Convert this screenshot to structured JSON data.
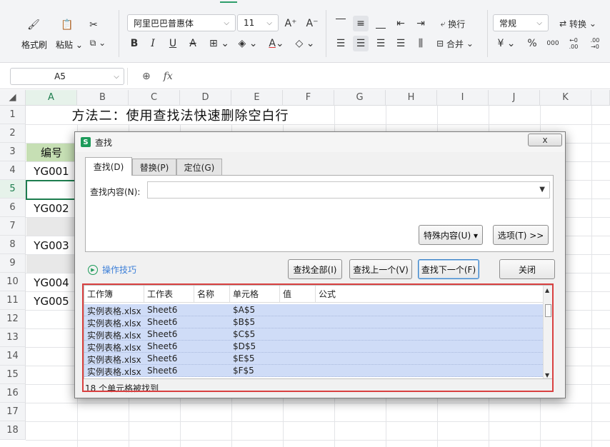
{
  "ribbon": {
    "format_painter": "格式刷",
    "paste": "粘贴",
    "font_name": "阿里巴巴普惠体",
    "font_size": "11",
    "font_grow": "A⁺",
    "font_shrink": "A⁻",
    "bold": "B",
    "italic": "I",
    "underline": "U",
    "strike": "A",
    "font_color": "A",
    "wrap": "换行",
    "merge": "合并",
    "number_format": "常规",
    "convert": "转换",
    "currency": "¥",
    "percent": "%",
    "thousands": "000",
    "inc_decimal": "←0 .00",
    "dec_decimal": ".00 →0"
  },
  "formula_bar": {
    "name_box": "A5",
    "fx": "fx"
  },
  "sheet": {
    "columns": [
      "A",
      "B",
      "C",
      "D",
      "E",
      "F",
      "G",
      "H",
      "I",
      "J",
      "K"
    ],
    "rows": [
      "1",
      "2",
      "3",
      "4",
      "5",
      "6",
      "7",
      "8",
      "9",
      "10",
      "11",
      "12",
      "13",
      "14",
      "15",
      "16",
      "17",
      "18"
    ],
    "title": "方法二：使用查找法快速删除空白行",
    "header_cell": "编号",
    "ids": {
      "r4": "YG001",
      "r6": "YG002",
      "r8": "YG003",
      "r10": "YG004",
      "r11": "YG005"
    }
  },
  "dialog": {
    "title": "查找",
    "close_glyph": "x",
    "logo": "S",
    "tabs": [
      "查找(D)",
      "替换(P)",
      "定位(G)"
    ],
    "find_label": "查找内容(N):",
    "find_value": "",
    "special_button": "特殊内容(U) ▾",
    "options_button": "选项(T) >>",
    "tips": "操作技巧",
    "find_all": "查找全部(I)",
    "find_prev": "查找上一个(V)",
    "find_next": "查找下一个(F)",
    "close": "关闭",
    "result_headers": [
      "工作簿",
      "工作表",
      "名称",
      "单元格",
      "值",
      "公式"
    ],
    "results": [
      {
        "book": "实例表格.xlsx",
        "sheet": "Sheet6",
        "cell": "$A$5"
      },
      {
        "book": "实例表格.xlsx",
        "sheet": "Sheet6",
        "cell": "$B$5"
      },
      {
        "book": "实例表格.xlsx",
        "sheet": "Sheet6",
        "cell": "$C$5"
      },
      {
        "book": "实例表格.xlsx",
        "sheet": "Sheet6",
        "cell": "$D$5"
      },
      {
        "book": "实例表格.xlsx",
        "sheet": "Sheet6",
        "cell": "$E$5"
      },
      {
        "book": "实例表格.xlsx",
        "sheet": "Sheet6",
        "cell": "$F$5"
      }
    ],
    "status": "18 个单元格被找到"
  },
  "colors": {
    "accent": "#1d7d4e",
    "header_fill": "#c6dfb4",
    "highlight_border": "#d94040",
    "result_selection": "#cfdcf7"
  }
}
